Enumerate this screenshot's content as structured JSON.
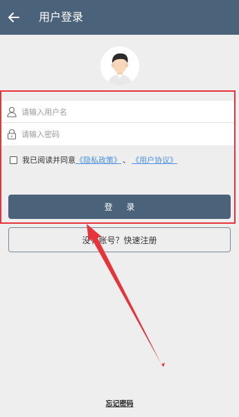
{
  "header": {
    "title": "用户登录",
    "back_icon": "arrow-left-icon",
    "background": "#4a627a"
  },
  "avatar": {
    "icon": "user-avatar-icon"
  },
  "form": {
    "username_placeholder": "请输入用户名",
    "username_value": "",
    "username_icon": "user-outline-icon",
    "password_placeholder": "请输入密码",
    "password_value": "",
    "password_icon": "lock-icon"
  },
  "agreement": {
    "checked": false,
    "prefix": "我已阅读并同意",
    "privacy_link": "《隐私政策》",
    "separator": "、",
    "terms_link": "《用户协议》",
    "link_color": "#4a90e2"
  },
  "actions": {
    "login_label": "登 录",
    "register_label": "没有账号？快速注册",
    "forgot_label": "忘记密码"
  },
  "annotation": {
    "color": "#e8333a"
  }
}
